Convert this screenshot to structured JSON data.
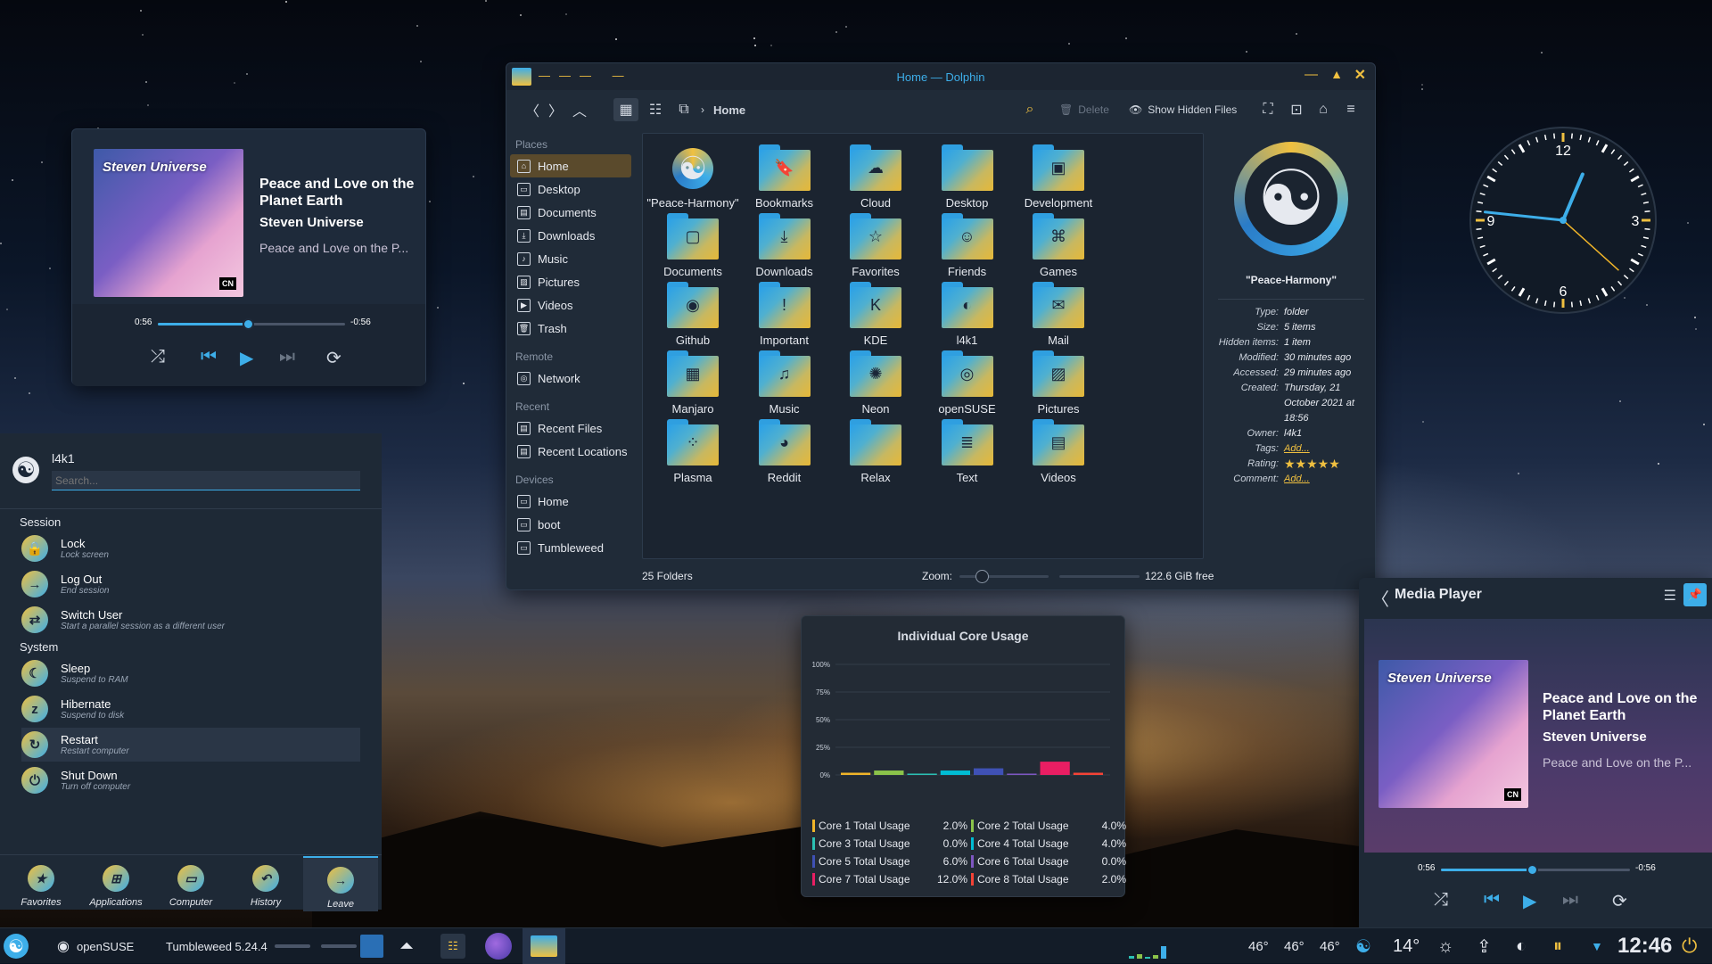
{
  "media_widget": {
    "cover_logo": "Steven Universe",
    "cover_badge": "CN",
    "title": "Peace and Love on the Planet Earth",
    "artist": "Steven Universe",
    "album": "Peace and Love on the P...",
    "elapsed": "0:56",
    "remaining": "-0:56",
    "progress": 0.48
  },
  "dolphin": {
    "title": "Home — Dolphin",
    "breadcrumb": "Home",
    "delete_label": "Delete",
    "hidden_label": "Show Hidden Files",
    "places_head": "Places",
    "places": [
      "Home",
      "Desktop",
      "Documents",
      "Downloads",
      "Music",
      "Pictures",
      "Videos",
      "Trash"
    ],
    "remote_head": "Remote",
    "remote": [
      "Network"
    ],
    "recent_head": "Recent",
    "recent": [
      "Recent Files",
      "Recent Locations"
    ],
    "devices_head": "Devices",
    "devices": [
      "Home",
      "boot",
      "Tumbleweed"
    ],
    "files": [
      {
        "name": "\"Peace-Harmony\"",
        "glyph": "☯"
      },
      {
        "name": "Bookmarks",
        "glyph": "🔖"
      },
      {
        "name": "Cloud",
        "glyph": "☁"
      },
      {
        "name": "Desktop",
        "glyph": ""
      },
      {
        "name": "Development",
        "glyph": "▣"
      },
      {
        "name": "Documents",
        "glyph": "▢"
      },
      {
        "name": "Downloads",
        "glyph": "⤓"
      },
      {
        "name": "Favorites",
        "glyph": "☆"
      },
      {
        "name": "Friends",
        "glyph": "☺"
      },
      {
        "name": "Games",
        "glyph": "⌘"
      },
      {
        "name": "Github",
        "glyph": "◉"
      },
      {
        "name": "Important",
        "glyph": "!"
      },
      {
        "name": "KDE",
        "glyph": "K"
      },
      {
        "name": "l4k1",
        "glyph": "◐"
      },
      {
        "name": "Mail",
        "glyph": "✉"
      },
      {
        "name": "Manjaro",
        "glyph": "▦"
      },
      {
        "name": "Music",
        "glyph": "♫"
      },
      {
        "name": "Neon",
        "glyph": "✺"
      },
      {
        "name": "openSUSE",
        "glyph": "◎"
      },
      {
        "name": "Pictures",
        "glyph": "▨"
      },
      {
        "name": "Plasma",
        "glyph": "⁘"
      },
      {
        "name": "Reddit",
        "glyph": "◕"
      },
      {
        "name": "Relax",
        "glyph": ""
      },
      {
        "name": "Text",
        "glyph": "≣"
      },
      {
        "name": "Videos",
        "glyph": "▤"
      }
    ],
    "info": {
      "name": "\"Peace-Harmony\"",
      "rows": [
        {
          "k": "Type:",
          "v": "folder"
        },
        {
          "k": "Size:",
          "v": "5 items"
        },
        {
          "k": "Hidden items:",
          "v": "1 item"
        },
        {
          "k": "Modified:",
          "v": "30 minutes ago"
        },
        {
          "k": "Accessed:",
          "v": "29 minutes ago"
        },
        {
          "k": "Created:",
          "v": "Thursday, 21 October 2021 at 18:56"
        },
        {
          "k": "Owner:",
          "v": "l4k1"
        },
        {
          "k": "Tags:",
          "v": "Add..."
        },
        {
          "k": "Rating:",
          "v": "★★★★★"
        },
        {
          "k": "Comment:",
          "v": "Add..."
        }
      ]
    },
    "status_count": "25 Folders",
    "zoom_label": "Zoom:",
    "free_space": "122.6 GiB free"
  },
  "clock": {
    "hour": 12,
    "minute": 46,
    "labels": [
      "12",
      "3",
      "6",
      "9"
    ]
  },
  "menu": {
    "user": "l4k1",
    "search_placeholder": "Search...",
    "session_head": "Session",
    "session": [
      {
        "t": "Lock",
        "s": "Lock screen",
        "g": "🔒"
      },
      {
        "t": "Log Out",
        "s": "End session",
        "g": "→"
      },
      {
        "t": "Switch User",
        "s": "Start a parallel session as a different user",
        "g": "⇄"
      }
    ],
    "system_head": "System",
    "system": [
      {
        "t": "Sleep",
        "s": "Suspend to RAM",
        "g": "☾"
      },
      {
        "t": "Hibernate",
        "s": "Suspend to disk",
        "g": "z"
      },
      {
        "t": "Restart",
        "s": "Restart computer",
        "g": "↻"
      },
      {
        "t": "Shut Down",
        "s": "Turn off computer",
        "g": "⏻"
      }
    ],
    "tabs": [
      "Favorites",
      "Applications",
      "Computer",
      "History",
      "Leave"
    ]
  },
  "cores": {
    "title": "Individual Core Usage",
    "colors": [
      "#f0b429",
      "#8bc34a",
      "#2bc0b4",
      "#00bcd4",
      "#3f51b5",
      "#7e57c2",
      "#e91e63",
      "#f44336"
    ],
    "legend": [
      {
        "name": "Core 1 Total Usage",
        "value": "2.0%"
      },
      {
        "name": "Core 2 Total Usage",
        "value": "4.0%"
      },
      {
        "name": "Core 3 Total Usage",
        "value": "0.0%"
      },
      {
        "name": "Core 4 Total Usage",
        "value": "4.0%"
      },
      {
        "name": "Core 5 Total Usage",
        "value": "6.0%"
      },
      {
        "name": "Core 6 Total Usage",
        "value": "0.0%"
      },
      {
        "name": "Core 7 Total Usage",
        "value": "12.0%"
      },
      {
        "name": "Core 8 Total Usage",
        "value": "2.0%"
      }
    ],
    "ticks": [
      "100%",
      "75%",
      "50%",
      "25%",
      "0%"
    ]
  },
  "chart_data": {
    "type": "bar",
    "title": "Individual Core Usage",
    "categories": [
      "Core 1 Total Usage",
      "Core 2 Total Usage",
      "Core 3 Total Usage",
      "Core 4 Total Usage",
      "Core 5 Total Usage",
      "Core 6 Total Usage",
      "Core 7 Total Usage",
      "Core 8 Total Usage"
    ],
    "values": [
      2,
      4,
      0,
      4,
      6,
      0,
      12,
      2
    ],
    "ylim": [
      0,
      100
    ]
  },
  "media_player": {
    "header": "Media Player",
    "cover_logo": "Steven Universe",
    "cover_badge": "CN",
    "title": "Peace and Love on the Planet Earth",
    "artist": "Steven Universe",
    "album": "Peace and Love on the P...",
    "elapsed": "0:56",
    "remaining": "-0:56",
    "progress": 0.48
  },
  "taskbar": {
    "distro": "openSUSE",
    "version": "Tumbleweed 5.24.4",
    "temps": [
      "46°",
      "46°",
      "46°"
    ],
    "weather": "14°",
    "time": "12:46"
  }
}
